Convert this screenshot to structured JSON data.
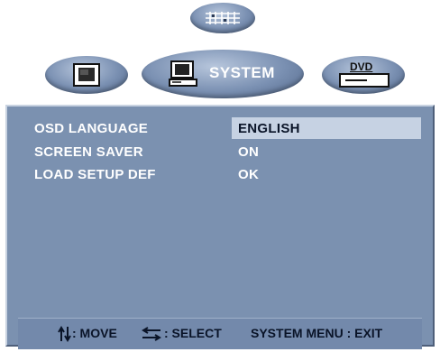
{
  "tabs": {
    "system_label": "SYSTEM",
    "dvd_label": "DVD"
  },
  "menu": {
    "rows": [
      {
        "label": "OSD LANGUAGE",
        "value": "ENGLISH",
        "selected": true
      },
      {
        "label": "SCREEN SAVER",
        "value": "ON",
        "selected": false
      },
      {
        "label": "LOAD SETUP DEF",
        "value": "OK",
        "selected": false
      }
    ]
  },
  "footer": {
    "move_label": ": MOVE",
    "select_label": ": SELECT",
    "exit_label": "SYSTEM MENU : EXIT"
  },
  "colors": {
    "panel": "#7b91b0",
    "selection": "#c6d2e3",
    "tab": "#7a90b2"
  },
  "icons": [
    "equalizer-icon",
    "tv-icon",
    "computer-icon",
    "dvd-player-icon",
    "up-down-arrows-icon",
    "left-right-arrows-icon"
  ]
}
